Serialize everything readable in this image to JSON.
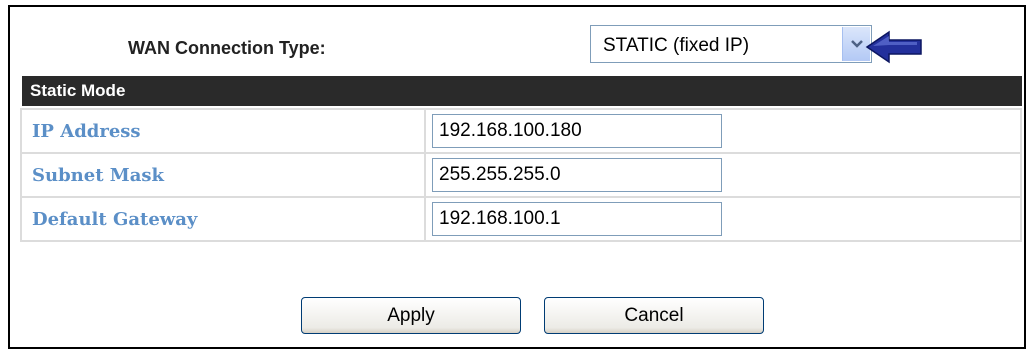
{
  "wan": {
    "label": "WAN Connection Type:",
    "selected": "STATIC (fixed IP)"
  },
  "section": {
    "title": "Static Mode"
  },
  "fields": [
    {
      "label": "IP Address",
      "value": "192.168.100.180"
    },
    {
      "label": "Subnet Mask",
      "value": "255.255.255.0"
    },
    {
      "label": "Default Gateway",
      "value": "192.168.100.1"
    }
  ],
  "buttons": {
    "apply": "Apply",
    "cancel": "Cancel"
  },
  "icons": {
    "dropdown": "chevron-down-icon",
    "pointer": "arrow-left-icon"
  },
  "colors": {
    "header_bg": "#2a2a2a",
    "label_text": "#5b8fc7",
    "arrow": "#1f2f9a"
  }
}
